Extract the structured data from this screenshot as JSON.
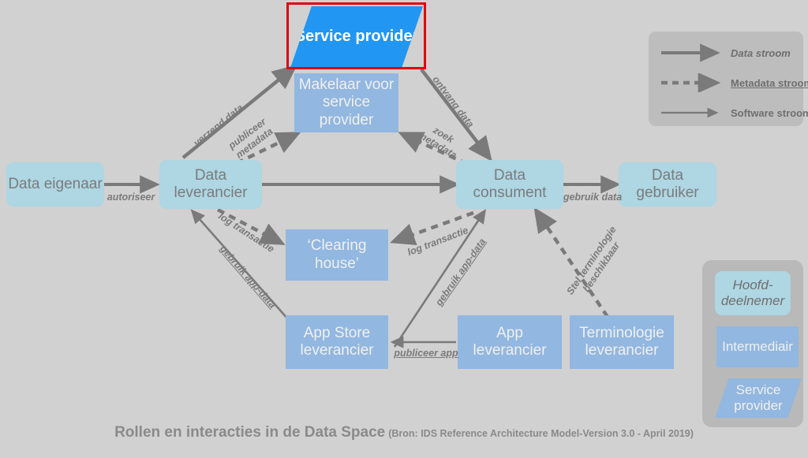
{
  "diagram": {
    "background_color": "#d1d1d1",
    "colors": {
      "main_participant": "#aed6e3",
      "intermediary": "#92b7e0",
      "service_provider_highlight": "#2196f3",
      "highlight_border": "#e2000f",
      "arrow": "#7a7a7a",
      "legend_panel": "#bdbdbd"
    },
    "nodes": [
      {
        "id": "data-eigenaar",
        "label": "Data eigenaar",
        "type": "main"
      },
      {
        "id": "data-leverancier",
        "label": "Data leverancier",
        "type": "main"
      },
      {
        "id": "data-consument",
        "label": "Data consument",
        "type": "main"
      },
      {
        "id": "data-gebruiker",
        "label": "Data gebruiker",
        "type": "main"
      },
      {
        "id": "service-provider",
        "label": "Service provider",
        "type": "service-provider-highlight"
      },
      {
        "id": "makelaar",
        "label": "Makelaar voor service provider",
        "type": "intermediary"
      },
      {
        "id": "clearing-house",
        "label": "‘Clearing house’",
        "type": "intermediary"
      },
      {
        "id": "app-store-leverancier",
        "label": "App Store leverancier",
        "type": "intermediary"
      },
      {
        "id": "app-leverancier",
        "label": "App leverancier",
        "type": "intermediary"
      },
      {
        "id": "terminologie-leverancier",
        "label": "Terminologie leverancier",
        "type": "intermediary"
      }
    ],
    "edge_labels": {
      "autoriseer": "autoriseer",
      "verzend_data": "verzend data",
      "publiceer_metadata_l1": "publiceer",
      "publiceer_metadata_l2": "metadata",
      "ontvang_data": "ontvang data",
      "zoek_metadata_l1": "zoek",
      "zoek_metadata_l2": "metadata",
      "gebruik_data": "gebruik data",
      "log_transactie_left": "log transactie",
      "log_transactie_right": "log transactie",
      "gebruik_app_data_left": "gebruik app-data",
      "gebruik_app_data_right": "gebruik app-data",
      "stel_terminologie_l1": "Stel terminologie",
      "stel_terminologie_l2": "beschikbaar",
      "publiceer_app": "publiceer app"
    },
    "legend_flows": {
      "items": [
        {
          "id": "data-stroom",
          "label": "Data stroom",
          "style": "solid"
        },
        {
          "id": "metadata-stroom",
          "label": "Metadata stroom",
          "style": "dashed"
        },
        {
          "id": "software-stroom",
          "label": "Software stroom",
          "style": "thin"
        }
      ]
    },
    "legend_shapes": {
      "items": [
        {
          "id": "hoofddeelnemer",
          "label": "Hoofd-deelnemer",
          "shape": "rounded-rect"
        },
        {
          "id": "intermediair",
          "label": "Intermediair",
          "shape": "rect"
        },
        {
          "id": "serviceprovider",
          "label": "Service provider",
          "shape": "parallelogram"
        }
      ]
    },
    "caption": {
      "title": "Rollen en interacties in de Data Space",
      "source": "(Bron: IDS Reference Architecture Model-Version 3.0 - April 2019)"
    }
  }
}
